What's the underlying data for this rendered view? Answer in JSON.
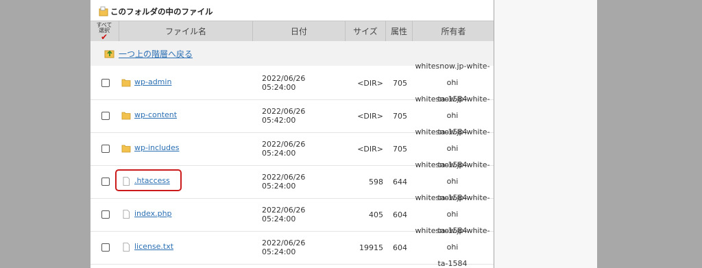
{
  "section_title": "このフォルダの中のファイル",
  "header": {
    "select_all_top": "すべて",
    "select_all_bottom": "選択",
    "select_all_check": "✔",
    "name": "ファイル名",
    "date": "日付",
    "size": "サイズ",
    "attr": "属性",
    "owner": "所有者"
  },
  "up_link": "一つ上の階層へ戻る",
  "files": [
    {
      "name": "wp-admin",
      "type": "folder",
      "date": "2022/06/26 05:24:00",
      "size": "<DIR>",
      "attr": "705",
      "owner_1": "whitesnow.jp-white-ohi",
      "owner_2": "ta-1584"
    },
    {
      "name": "wp-content",
      "type": "folder",
      "date": "2022/06/26 05:42:00",
      "size": "<DIR>",
      "attr": "705",
      "owner_1": "whitesnow.jp-white-ohi",
      "owner_2": "ta-1584"
    },
    {
      "name": "wp-includes",
      "type": "folder",
      "date": "2022/06/26 05:24:00",
      "size": "<DIR>",
      "attr": "705",
      "owner_1": "whitesnow.jp-white-ohi",
      "owner_2": "ta-1584"
    },
    {
      "name": ".htaccess",
      "type": "file",
      "date": "2022/06/26 05:24:00",
      "size": "598",
      "attr": "644",
      "owner_1": "whitesnow.jp-white-ohi",
      "owner_2": "ta-1584"
    },
    {
      "name": "index.php",
      "type": "file",
      "date": "2022/06/26 05:24:00",
      "size": "405",
      "attr": "604",
      "owner_1": "whitesnow.jp-white-ohi",
      "owner_2": "ta-1584"
    },
    {
      "name": "license.txt",
      "type": "file",
      "date": "2022/06/26 05:24:00",
      "size": "19915",
      "attr": "604",
      "owner_1": "whitesnow.jp-white-ohi",
      "owner_2": "ta-1584"
    }
  ],
  "highlight_color": "#cc1a1a",
  "link_color": "#2a6fb3",
  "folder_color": "#f2c14e"
}
